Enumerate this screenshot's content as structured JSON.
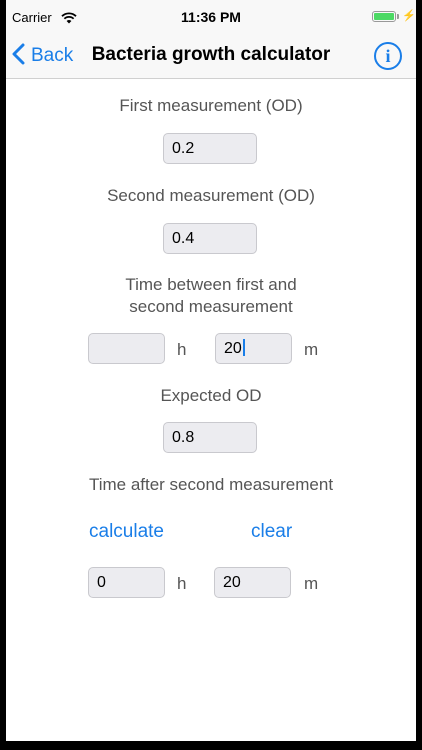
{
  "status_bar": {
    "carrier": "Carrier",
    "time": "11:36 PM"
  },
  "nav": {
    "back_label": "Back",
    "title": "Bacteria growth calculator",
    "info_glyph": "i"
  },
  "form": {
    "first_measurement_label": "First measurement (OD)",
    "first_measurement_value": "0.2",
    "second_measurement_label": "Second measurement (OD)",
    "second_measurement_value": "0.4",
    "time_between_label_line1": "Time between first and",
    "time_between_label_line2": "second measurement",
    "time_between_hours_value": "",
    "time_between_minutes_value": "20",
    "expected_od_label": "Expected OD",
    "expected_od_value": "0.8",
    "time_after_label": "Time after second measurement",
    "calculate_label": "calculate",
    "clear_label": "clear",
    "result_hours_value": "0",
    "result_minutes_value": "20",
    "hours_unit": "h",
    "minutes_unit": "m"
  },
  "colors": {
    "accent": "#1a7ee8",
    "field_background": "#ececf0",
    "battery": "#4cd964"
  }
}
